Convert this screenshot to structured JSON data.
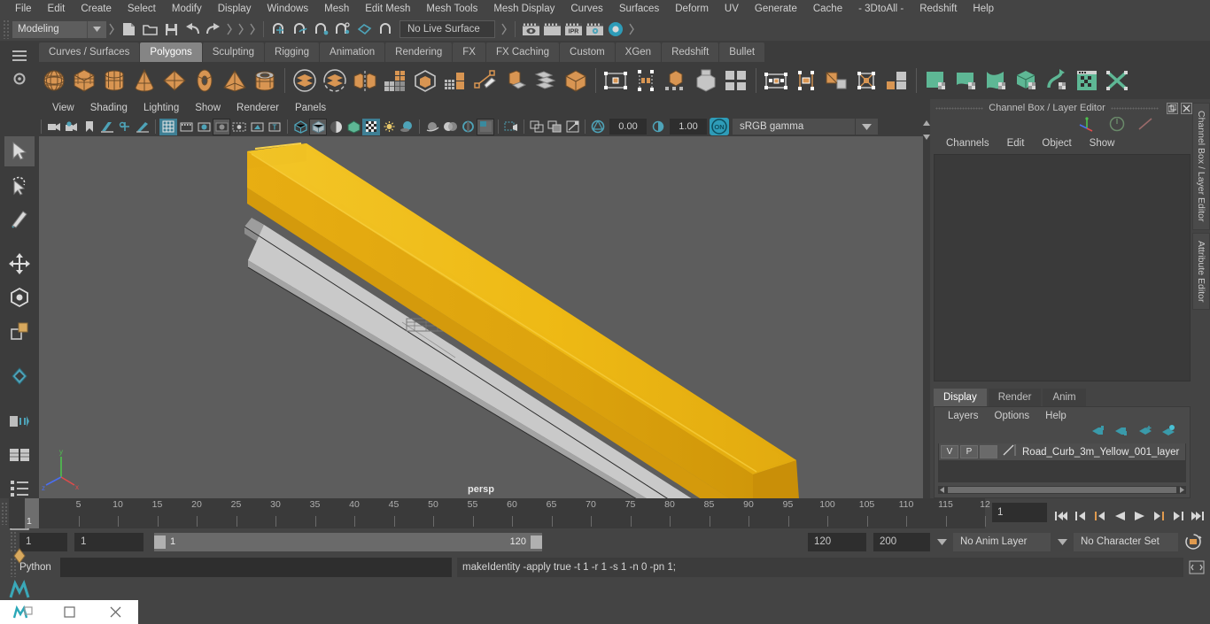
{
  "app": {
    "title": "Autodesk Maya"
  },
  "menubar": {
    "items": [
      "File",
      "Edit",
      "Create",
      "Select",
      "Modify",
      "Display",
      "Windows",
      "Mesh",
      "Edit Mesh",
      "Mesh Tools",
      "Mesh Display",
      "Curves",
      "Surfaces",
      "Deform",
      "UV",
      "Generate",
      "Cache",
      "- 3DtoAll -",
      "Redshift",
      "Help"
    ]
  },
  "statusline": {
    "mode": "Modeling",
    "live_surface": "No Live Surface",
    "icons": [
      "new-scene-icon",
      "open-scene-icon",
      "save-scene-icon",
      "undo-icon",
      "redo-icon",
      "snap-to-grid-icon",
      "snap-to-curve-icon",
      "snap-to-point-icon",
      "snap-to-projected-center-icon",
      "snap-to-view-plane-icon",
      "make-live-icon",
      "render-view-icon",
      "render-current-frame-icon",
      "ipr-render-icon",
      "render-settings-icon",
      "hypershade-icon"
    ],
    "ipr_label": "IPR"
  },
  "shelf": {
    "tabs": [
      "Curves / Surfaces",
      "Polygons",
      "Sculpting",
      "Rigging",
      "Animation",
      "Rendering",
      "FX",
      "FX Caching",
      "Custom",
      "XGen",
      "Redshift",
      "Bullet"
    ],
    "active_tab": "Polygons",
    "items": [
      {
        "name": "poly-sphere-icon",
        "kind": "sphere"
      },
      {
        "name": "poly-cube-icon",
        "kind": "cube"
      },
      {
        "name": "poly-cylinder-icon",
        "kind": "cylinder"
      },
      {
        "name": "poly-cone-icon",
        "kind": "cone"
      },
      {
        "name": "poly-plane-icon",
        "kind": "plane"
      },
      {
        "name": "poly-torus-icon",
        "kind": "torus"
      },
      {
        "name": "poly-pyramid-icon",
        "kind": "pyramid"
      },
      {
        "name": "poly-pipe-icon",
        "kind": "pipe"
      },
      {
        "name": "combine-icon",
        "kind": "combine"
      },
      {
        "name": "separate-icon",
        "kind": "separate"
      },
      {
        "name": "mirror-geometry-icon",
        "kind": "mirror"
      },
      {
        "name": "smooth-icon",
        "kind": "smooth"
      },
      {
        "name": "boolean-icon",
        "kind": "boolean"
      },
      {
        "name": "reduce-icon",
        "kind": "reduce"
      },
      {
        "name": "multi-cut-icon",
        "kind": "multicut"
      },
      {
        "name": "extrude-icon",
        "kind": "extrude"
      },
      {
        "name": "bridge-icon",
        "kind": "bridge"
      },
      {
        "name": "bevel-icon",
        "kind": "bevel"
      },
      {
        "name": "uv-planar-icon",
        "kind": "uvplanar"
      },
      {
        "name": "uv-cylindrical-icon",
        "kind": "uvcyl"
      },
      {
        "name": "uv-automatic-icon",
        "kind": "uvauto"
      },
      {
        "name": "uv-camera-icon",
        "kind": "uvcam"
      },
      {
        "name": "uv-layout-icon",
        "kind": "uvlayout"
      },
      {
        "name": "sculpt-plane-icon",
        "kind": "sculptplane"
      },
      {
        "name": "sculpt-curve-icon",
        "kind": "sculptcurve"
      },
      {
        "name": "sculpt-shape-icon",
        "kind": "sculptshape"
      },
      {
        "name": "sculpt-cube-icon",
        "kind": "sculptcube"
      },
      {
        "name": "sculpt-wave-icon",
        "kind": "sculptwave"
      },
      {
        "name": "texture-editor-icon",
        "kind": "texeditor"
      },
      {
        "name": "uv-cross-icon",
        "kind": "uvcross"
      }
    ]
  },
  "viewport": {
    "panel_menus": [
      "View",
      "Shading",
      "Lighting",
      "Show",
      "Renderer",
      "Panels"
    ],
    "camera_label": "persp",
    "exposure_value": "0.00",
    "gamma_value": "1.00",
    "color_space": "sRGB gamma",
    "color_mgmt_toggle": "ON",
    "toolbar_icons": [
      "select-camera-icon",
      "camera-attributes-icon",
      "bookmark-icon",
      "image-plane-icon",
      "two-d-pan-zoom-icon",
      "grease-pencil-icon",
      "grid-toggle-icon",
      "film-gate-icon",
      "resolution-gate-icon",
      "gate-mask-icon",
      "field-chart-icon",
      "safe-action-icon",
      "safe-title-icon",
      "wireframe-icon",
      "smooth-shade-icon",
      "shaded-wireframe-icon",
      "hardware-texturing-icon",
      "use-default-lighting-icon",
      "shadows-icon",
      "screen-space-ao-icon",
      "motion-blur-icon",
      "multisample-icon",
      "depth-of-field-icon",
      "isolate-select-icon",
      "xray-icon",
      "xray-joints-icon",
      "xray-active-components-icon",
      "exposure-icon",
      "gamma-icon",
      "color-management-icon"
    ],
    "left_tools": [
      "select-tool-icon",
      "lasso-select-tool-icon",
      "paint-select-tool-icon",
      "move-tool-icon",
      "rotate-tool-icon",
      "scale-tool-icon",
      "last-tool-icon",
      "show-manipulator-icon",
      "component-editor-icon",
      "outliner-icon",
      "attribute-editor-icon",
      "hypergraph-icon",
      "graph-editor-icon",
      "maya-logo-icon"
    ]
  },
  "channel_box": {
    "panel_title": "Channel Box / Layer Editor",
    "menus": [
      "Channels",
      "Edit",
      "Object",
      "Show"
    ],
    "empty": ""
  },
  "layer_editor": {
    "tabs": [
      "Display",
      "Render",
      "Anim"
    ],
    "active_tab": "Display",
    "menus": [
      "Layers",
      "Options",
      "Help"
    ],
    "buttons": [
      "move-layer-up-icon",
      "move-layer-down-icon",
      "new-layer-icon",
      "new-layer-from-selected-icon"
    ],
    "layers": [
      {
        "visibility": "V",
        "playback": "P",
        "color_swatch": "",
        "name": "Road_Curb_3m_Yellow_001_layer"
      }
    ]
  },
  "docked_tabs": [
    "Channel Box / Layer Editor",
    "Attribute Editor"
  ],
  "timeline": {
    "ticks": [
      5,
      10,
      15,
      20,
      25,
      30,
      35,
      40,
      45,
      50,
      55,
      60,
      65,
      70,
      75,
      80,
      85,
      90,
      95,
      100,
      105,
      110,
      115,
      "12"
    ],
    "current_frame": "1",
    "playhead_label": "1",
    "transport": [
      "go-to-start-icon",
      "step-back-keyframe-icon",
      "step-back-frame-icon",
      "play-backwards-icon",
      "play-forwards-icon",
      "step-forward-frame-icon",
      "step-forward-keyframe-icon",
      "go-to-end-icon"
    ]
  },
  "range_slider": {
    "anim_start": "1",
    "range_start": "1",
    "slider_start_label": "1",
    "slider_end_label": "120",
    "range_end": "120",
    "anim_end": "200",
    "anim_layer": "No Anim Layer",
    "character_set": "No Character Set",
    "buttons": [
      "auto-key-icon",
      "animation-preferences-icon"
    ]
  },
  "command_line": {
    "language": "Python",
    "input_value": "",
    "result": "makeIdentity -apply true -t 1 -r 1 -s 1 -n 0 -pn 1;",
    "script_editor_icon": "script-editor-icon"
  },
  "taskbar": {
    "items": [
      "maya-app-icon",
      "restore-window-icon",
      "maximize-window-icon",
      "close-window-icon"
    ]
  },
  "colors": {
    "app_bg": "#444444",
    "panel_bg": "#3c3c3c",
    "viewport_bg": "#5d5d5d",
    "accent_teal": "#4ea3b8",
    "accent_orange": "#e09a4e",
    "shelf_poly_orange": "#d89552",
    "shelf_uv_green": "#5eb795",
    "model_yellow": "#e8b013",
    "model_concrete": "#c9c9c9",
    "active_tab": "#858585",
    "layer_row": "#4e4e4e"
  }
}
